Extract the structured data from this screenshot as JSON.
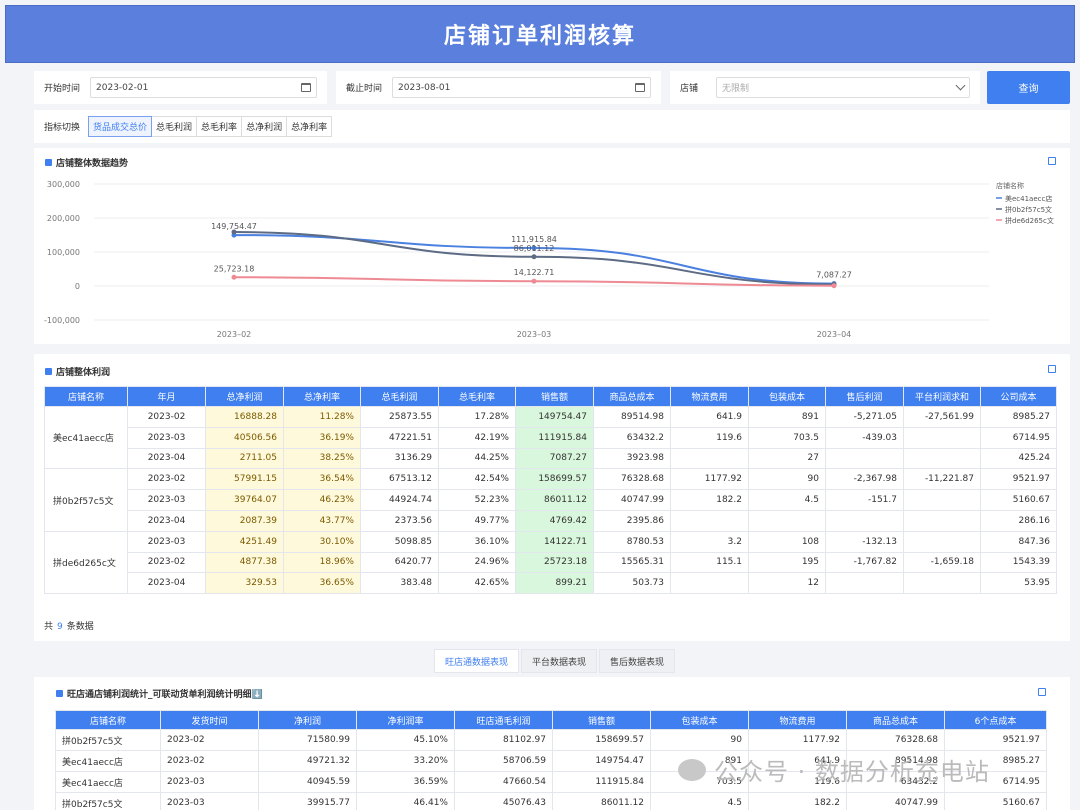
{
  "header": {
    "title": "店铺订单利润核算"
  },
  "filters": {
    "start_label": "开始时间",
    "start_value": "2023-02-01",
    "end_label": "截止时间",
    "end_value": "2023-08-01",
    "store_label": "店铺",
    "store_placeholder": "无限制",
    "query_label": "查询"
  },
  "metric_tabs": {
    "label": "指标切换",
    "items": [
      "货品成交总价",
      "总毛利润",
      "总毛利率",
      "总净利润",
      "总净利率"
    ]
  },
  "trend": {
    "title": "店铺整体数据趋势",
    "legend_title": "店铺名称"
  },
  "chart_data": {
    "type": "line",
    "categories": [
      "2023–02",
      "2023–03",
      "2023–04"
    ],
    "ylim": [
      -100000,
      300000
    ],
    "yticks": [
      "300,000",
      "200,000",
      "100,000",
      "0",
      "-100,000"
    ],
    "series": [
      {
        "name": "美ec41aecc店",
        "color": "#4a80e0",
        "values": [
          149754.47,
          111915.84,
          7087.27
        ],
        "labels": [
          "149,754.47",
          "111,915.84",
          "7,087.27"
        ]
      },
      {
        "name": "拼0b2f57c5文",
        "color": "#5d6b85",
        "values": [
          158699.57,
          86011.12,
          4769.42
        ],
        "labels": [
          "",
          "86,011.12",
          ""
        ]
      },
      {
        "name": "拼de6d265c文",
        "color": "#ee8a93",
        "values": [
          25723.18,
          14122.71,
          899.21
        ],
        "labels": [
          "25,723.18",
          "14,122.71",
          ""
        ]
      }
    ]
  },
  "profit": {
    "title": "店铺整体利润",
    "headers": [
      "店铺名称",
      "年月",
      "总净利润",
      "总净利率",
      "总毛利润",
      "总毛利率",
      "销售额",
      "商品总成本",
      "物流费用",
      "包装成本",
      "售后利润",
      "平台利润求和",
      "公司成本"
    ],
    "groups": [
      {
        "store": "美ec41aecc店",
        "rows": [
          [
            "2023-02",
            "16888.28",
            "11.28%",
            "25873.55",
            "17.28%",
            "149754.47",
            "89514.98",
            "641.9",
            "891",
            "-5,271.05",
            "-27,561.99",
            "8985.27"
          ],
          [
            "2023-03",
            "40506.56",
            "36.19%",
            "47221.51",
            "42.19%",
            "111915.84",
            "63432.2",
            "119.6",
            "703.5",
            "-439.03",
            "",
            "6714.95"
          ],
          [
            "2023-04",
            "2711.05",
            "38.25%",
            "3136.29",
            "44.25%",
            "7087.27",
            "3923.98",
            "",
            "27",
            "",
            "",
            "425.24"
          ]
        ]
      },
      {
        "store": "拼0b2f57c5文",
        "rows": [
          [
            "2023-02",
            "57991.15",
            "36.54%",
            "67513.12",
            "42.54%",
            "158699.57",
            "76328.68",
            "1177.92",
            "90",
            "-2,367.98",
            "-11,221.87",
            "9521.97"
          ],
          [
            "2023-03",
            "39764.07",
            "46.23%",
            "44924.74",
            "52.23%",
            "86011.12",
            "40747.99",
            "182.2",
            "4.5",
            "-151.7",
            "",
            "5160.67"
          ],
          [
            "2023-04",
            "2087.39",
            "43.77%",
            "2373.56",
            "49.77%",
            "4769.42",
            "2395.86",
            "",
            "",
            "",
            "",
            "286.16"
          ]
        ]
      },
      {
        "store": "拼de6d265c文",
        "rows": [
          [
            "2023-03",
            "4251.49",
            "30.10%",
            "5098.85",
            "36.10%",
            "14122.71",
            "8780.53",
            "3.2",
            "108",
            "-132.13",
            "",
            "847.36"
          ],
          [
            "2023-02",
            "4877.38",
            "18.96%",
            "6420.77",
            "24.96%",
            "25723.18",
            "15565.31",
            "115.1",
            "195",
            "-1,767.82",
            "-1,659.18",
            "1543.39"
          ],
          [
            "2023-04",
            "329.53",
            "36.65%",
            "383.48",
            "42.65%",
            "899.21",
            "503.73",
            "",
            "12",
            "",
            "",
            "53.95"
          ]
        ]
      }
    ],
    "total_prefix": "共",
    "total_count": "9",
    "total_suffix": "条数据"
  },
  "sub_tabs": [
    "旺店通数据表现",
    "平台数据表现",
    "售后数据表现"
  ],
  "detail": {
    "title": "旺店通店铺利润统计_可联动货单利润统计明细⬇️",
    "headers": [
      "店铺名称",
      "发货时间",
      "净利润",
      "净利润率",
      "旺店通毛利润",
      "销售额",
      "包装成本",
      "物流费用",
      "商品总成本",
      "6个点成本"
    ],
    "rows": [
      [
        "拼0b2f57c5文",
        "2023-02",
        "71580.99",
        "45.10%",
        "81102.97",
        "158699.57",
        "90",
        "1177.92",
        "76328.68",
        "9521.97"
      ],
      [
        "美ec41aecc店",
        "2023-02",
        "49721.32",
        "33.20%",
        "58706.59",
        "149754.47",
        "891",
        "641.9",
        "89514.98",
        "8985.27"
      ],
      [
        "美ec41aecc店",
        "2023-03",
        "40945.59",
        "36.59%",
        "47660.54",
        "111915.84",
        "703.5",
        "119.6",
        "63432.2",
        "6714.95"
      ],
      [
        "拼0b2f57c5文",
        "2023-03",
        "39915.77",
        "46.41%",
        "45076.43",
        "86011.12",
        "4.5",
        "182.2",
        "40747.99",
        "5160.67"
      ]
    ]
  },
  "watermark": {
    "text": "公众号 · 数据分析充电站"
  }
}
